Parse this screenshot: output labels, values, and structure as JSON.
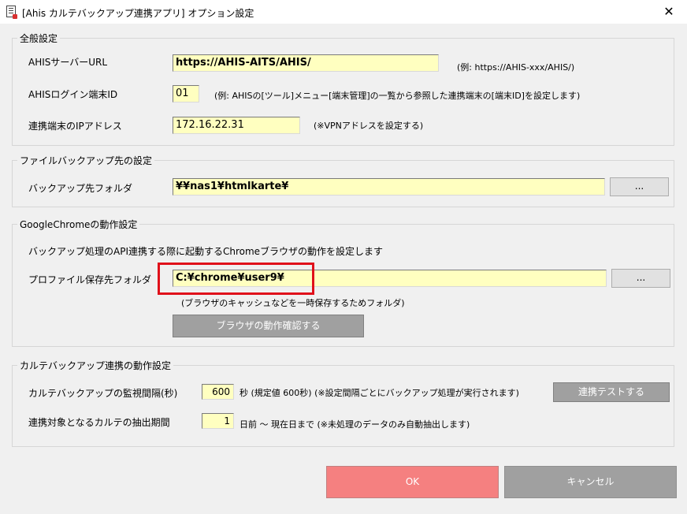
{
  "window": {
    "title": "[Ahis カルテバックアップ連携アプリ] オプション設定",
    "close_glyph": "✕"
  },
  "general": {
    "section_title": "全般設定",
    "server_url_label": "AHISサーバーURL",
    "server_url_value": "https://AHIS-AITS/AHIS/",
    "server_url_hint": "(例: https://AHIS-xxx/AHIS/)",
    "login_id_label": "AHISログイン端末ID",
    "login_id_value": "01",
    "login_id_hint": "(例: AHISの[ツール]メニュー[端末管理]の一覧から参照した連携端末の[端末ID]を設定します)",
    "ip_label": "連携端末のIPアドレス",
    "ip_value": "172.16.22.31",
    "ip_hint": "(※VPNアドレスを設定する)"
  },
  "backup": {
    "section_title": "ファイルバックアップ先の設定",
    "folder_label": "バックアップ先フォルダ",
    "folder_value": "¥¥nas1¥htmlkarte¥",
    "browse_label": "..."
  },
  "chrome": {
    "section_title": "GoogleChromeの動作設定",
    "description": "バックアップ処理のAPI連携する際に起動するChromeブラウザの動作を設定します",
    "profile_label": "プロファイル保存先フォルダ",
    "profile_value": "C:¥chrome¥user9¥",
    "browse_label": "...",
    "profile_hint": "(ブラウザのキャッシュなどを一時保存するためフォルダ)",
    "check_button": "ブラウザの動作確認する"
  },
  "karte": {
    "section_title": "カルテバックアップ連携の動作設定",
    "interval_label": "カルテバックアップの監視間隔(秒)",
    "interval_value": "600",
    "interval_hint": "秒 (規定値 600秒) (※設定間隔ごとにバックアップ処理が実行されます)",
    "test_button": "連携テストする",
    "period_label": "連携対象となるカルテの抽出期間",
    "period_value": "1",
    "period_hint": "日前 〜 現在日まで (※未処理のデータのみ自動抽出します)"
  },
  "footer": {
    "ok_label": "OK",
    "cancel_label": "キャンセル"
  },
  "colors": {
    "field_bg": "#ffffc0",
    "highlight": "#e0101a",
    "ok_bg": "#f58080"
  }
}
